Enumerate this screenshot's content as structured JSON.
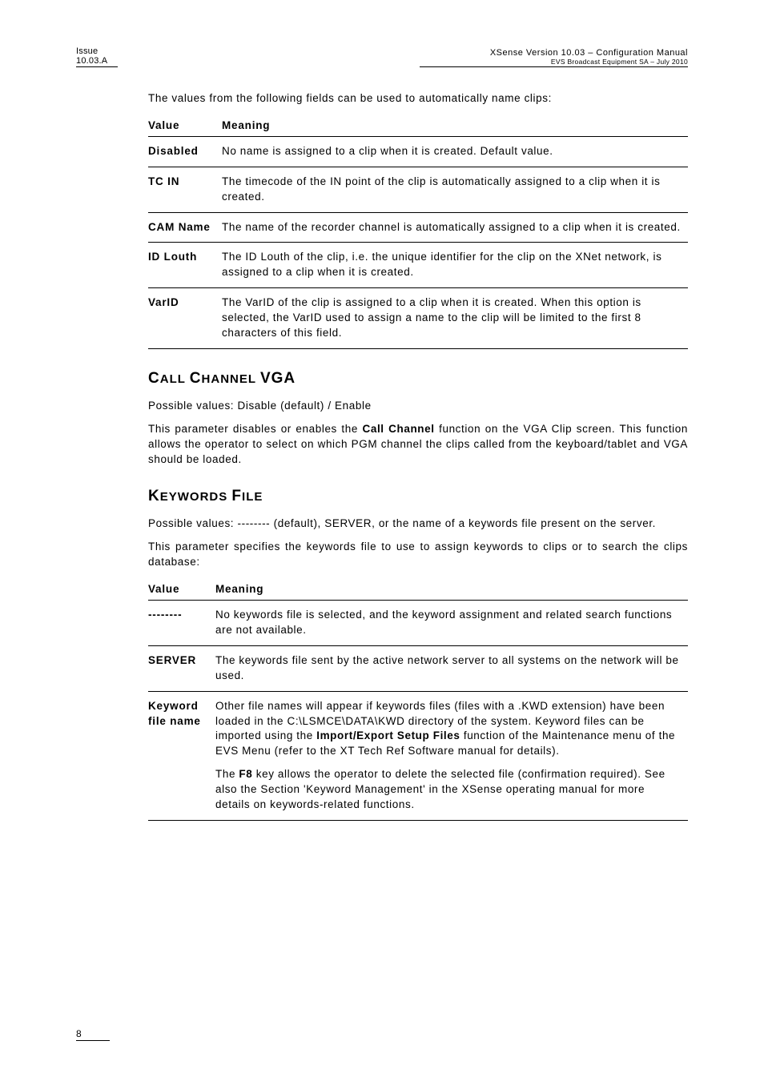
{
  "header": {
    "issue_label": "Issue",
    "issue_value": "10.03.A",
    "product_line": "XSense    Version 10.03 – Configuration Manual",
    "company_line": "EVS Broadcast Equipment SA – July 2010"
  },
  "intro": "The values from the following fields can be used to automatically name clips:",
  "table1_headers": {
    "value": "Value",
    "meaning": "Meaning"
  },
  "table1_rows": [
    {
      "key": "Disabled",
      "text": "No name is assigned to a clip when it is created. Default value."
    },
    {
      "key": "TC IN",
      "text": "The timecode of the IN point of the clip is automatically assigned to a clip when it is created."
    },
    {
      "key": "CAM Name",
      "text": "The name of the recorder channel is automatically assigned to a clip when it is created."
    },
    {
      "key": "ID Louth",
      "text": "The ID Louth of the clip, i.e. the unique identifier for the clip on the XNet network, is assigned to a clip when it is created."
    },
    {
      "key": "VarID",
      "text": "The VarID of the clip is assigned to a clip when it is created. When this option is selected, the VarID used to assign a name to the clip will be limited to the first 8 characters of this field."
    }
  ],
  "section1": {
    "title_big1": "C",
    "title_small1": "ALL ",
    "title_big2": "C",
    "title_small2": "HANNEL ",
    "title_big3": "VGA",
    "p1": "Possible values: Disable (default) / Enable",
    "p2_pre": "This parameter disables or enables the ",
    "p2_bold": "Call Channel",
    "p2_post": " function on the VGA Clip screen. This function allows the operator to select on which PGM channel the clips called from the keyboard/tablet and VGA should be loaded."
  },
  "section2": {
    "title_big1": "K",
    "title_small1": "EYWORDS ",
    "title_big2": "F",
    "title_small2": "ILE",
    "p1": "Possible values: -------- (default), SERVER, or the name of a keywords file present on the server.",
    "p2": "This parameter specifies the keywords file to use to assign keywords to clips or to search the clips database:"
  },
  "table2_headers": {
    "value": "Value",
    "meaning": "Meaning"
  },
  "table2_rows": {
    "r0_key": "--------",
    "r0_text": "No keywords file is selected, and the keyword assignment and related search functions are not available.",
    "r1_key": "SERVER",
    "r1_text": "The keywords file sent by the active network server to all systems on the network will be used.",
    "r2_key": "Keyword file name",
    "r2_p1_pre": "Other file names will appear if keywords files (files with a .KWD extension) have been loaded in the C:\\LSMCE\\DATA\\KWD directory of the system. Keyword files can be imported using the ",
    "r2_p1_b1": "Import/Export Setup Files",
    "r2_p1_post": " function of the Maintenance menu of the EVS Menu (refer to the XT Tech Ref Software manual for details).",
    "r2_p2_pre": "The ",
    "r2_p2_b1": "F8",
    "r2_p2_post": " key allows the operator to delete the selected file (confirmation required). See also the Section 'Keyword Management' in the XSense operating manual for more details on keywords-related functions."
  },
  "footer": {
    "page": "8"
  }
}
